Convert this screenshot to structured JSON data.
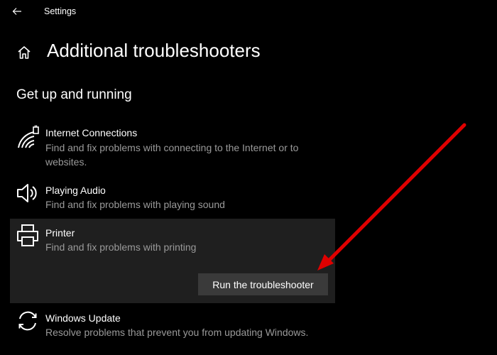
{
  "window": {
    "title": "Settings"
  },
  "page": {
    "title": "Additional troubleshooters"
  },
  "section": {
    "title": "Get up and running"
  },
  "troubleshooters": [
    {
      "name": "Internet Connections",
      "description": "Find and fix problems with connecting to the Internet or to websites.",
      "icon": "wifi-icon"
    },
    {
      "name": "Playing Audio",
      "description": "Find and fix problems with playing sound",
      "icon": "speaker-icon"
    },
    {
      "name": "Printer",
      "description": "Find and fix problems with printing",
      "icon": "printer-icon",
      "selected": true,
      "button_label": "Run the troubleshooter"
    },
    {
      "name": "Windows Update",
      "description": "Resolve problems that prevent you from updating Windows.",
      "icon": "sync-icon"
    }
  ],
  "colors": {
    "background": "#000000",
    "selected_background": "#1f1f1f",
    "button_background": "#3a3a3a",
    "secondary_text": "#9a9a9a",
    "annotation_arrow": "#e00000"
  }
}
